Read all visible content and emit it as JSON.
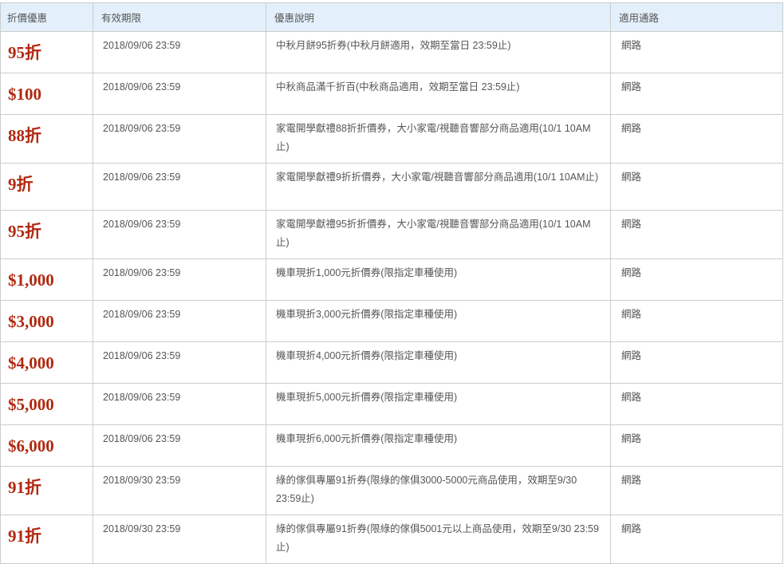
{
  "table": {
    "headers": [
      "折價優惠",
      "有效期限",
      "優惠說明",
      "適用通路"
    ],
    "rows": [
      {
        "discount": "95折",
        "expiry": "2018/09/06 23:59",
        "description": "中秋月餅95折券(中秋月餅適用，效期至當日 23:59止)",
        "channel": "網路"
      },
      {
        "discount": "$100",
        "expiry": "2018/09/06 23:59",
        "description": "中秋商品滿千折百(中秋商品適用，效期至當日 23:59止)",
        "channel": "網路"
      },
      {
        "discount": "88折",
        "expiry": "2018/09/06 23:59",
        "description": "家電開學獻禮88折折價券，大小家電/視聽音響部分商品適用(10/1 10AM止)",
        "channel": "網路"
      },
      {
        "discount": "9折",
        "expiry": "2018/09/06 23:59",
        "description": "家電開學獻禮9折折價券，大小家電/視聽音響部分商品適用(10/1 10AM止)",
        "channel": "網路"
      },
      {
        "discount": "95折",
        "expiry": "2018/09/06 23:59",
        "description": "家電開學獻禮95折折價券，大小家電/視聽音響部分商品適用(10/1 10AM止)",
        "channel": "網路"
      },
      {
        "discount": "$1,000",
        "expiry": "2018/09/06 23:59",
        "description": "機車現折1,000元折價券(限指定車種使用)",
        "channel": "網路"
      },
      {
        "discount": "$3,000",
        "expiry": "2018/09/06 23:59",
        "description": "機車現折3,000元折價券(限指定車種使用)",
        "channel": "網路"
      },
      {
        "discount": "$4,000",
        "expiry": "2018/09/06 23:59",
        "description": "機車現折4,000元折價券(限指定車種使用)",
        "channel": "網路"
      },
      {
        "discount": "$5,000",
        "expiry": "2018/09/06 23:59",
        "description": "機車現折5,000元折價券(限指定車種使用)",
        "channel": "網路"
      },
      {
        "discount": "$6,000",
        "expiry": "2018/09/06 23:59",
        "description": "機車現折6,000元折價券(限指定車種使用)",
        "channel": "網路"
      },
      {
        "discount": "91折",
        "expiry": "2018/09/30 23:59",
        "description": "綠的傢俱專屬91折券(限綠的傢俱3000-5000元商品使用，效期至9/30 23:59止)",
        "channel": "網路"
      },
      {
        "discount": "91折",
        "expiry": "2018/09/30 23:59",
        "description": "綠的傢俱專屬91折券(限綠的傢俱5001元以上商品使用，效期至9/30 23:59止)",
        "channel": "網路"
      }
    ]
  },
  "colors": {
    "header_bg": "#e3f0fb",
    "discount_text": "#b12810",
    "border": "#cccccc",
    "body_text": "#555555"
  }
}
